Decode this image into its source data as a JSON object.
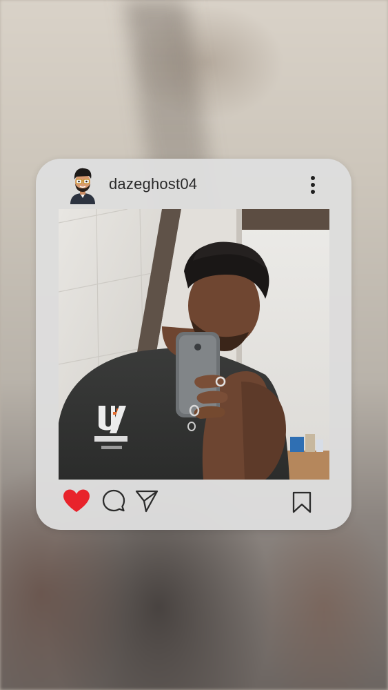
{
  "post": {
    "username": "dazeghost04",
    "liked": true
  },
  "icons": {
    "avatar": "bitmoji-avatar",
    "more": "more-vertical-icon",
    "like": "heart-icon",
    "comment": "comment-icon",
    "share": "send-icon",
    "save": "bookmark-icon"
  },
  "colors": {
    "like": "#e8232b",
    "card": "#dedede",
    "text": "#2b2b2b"
  }
}
